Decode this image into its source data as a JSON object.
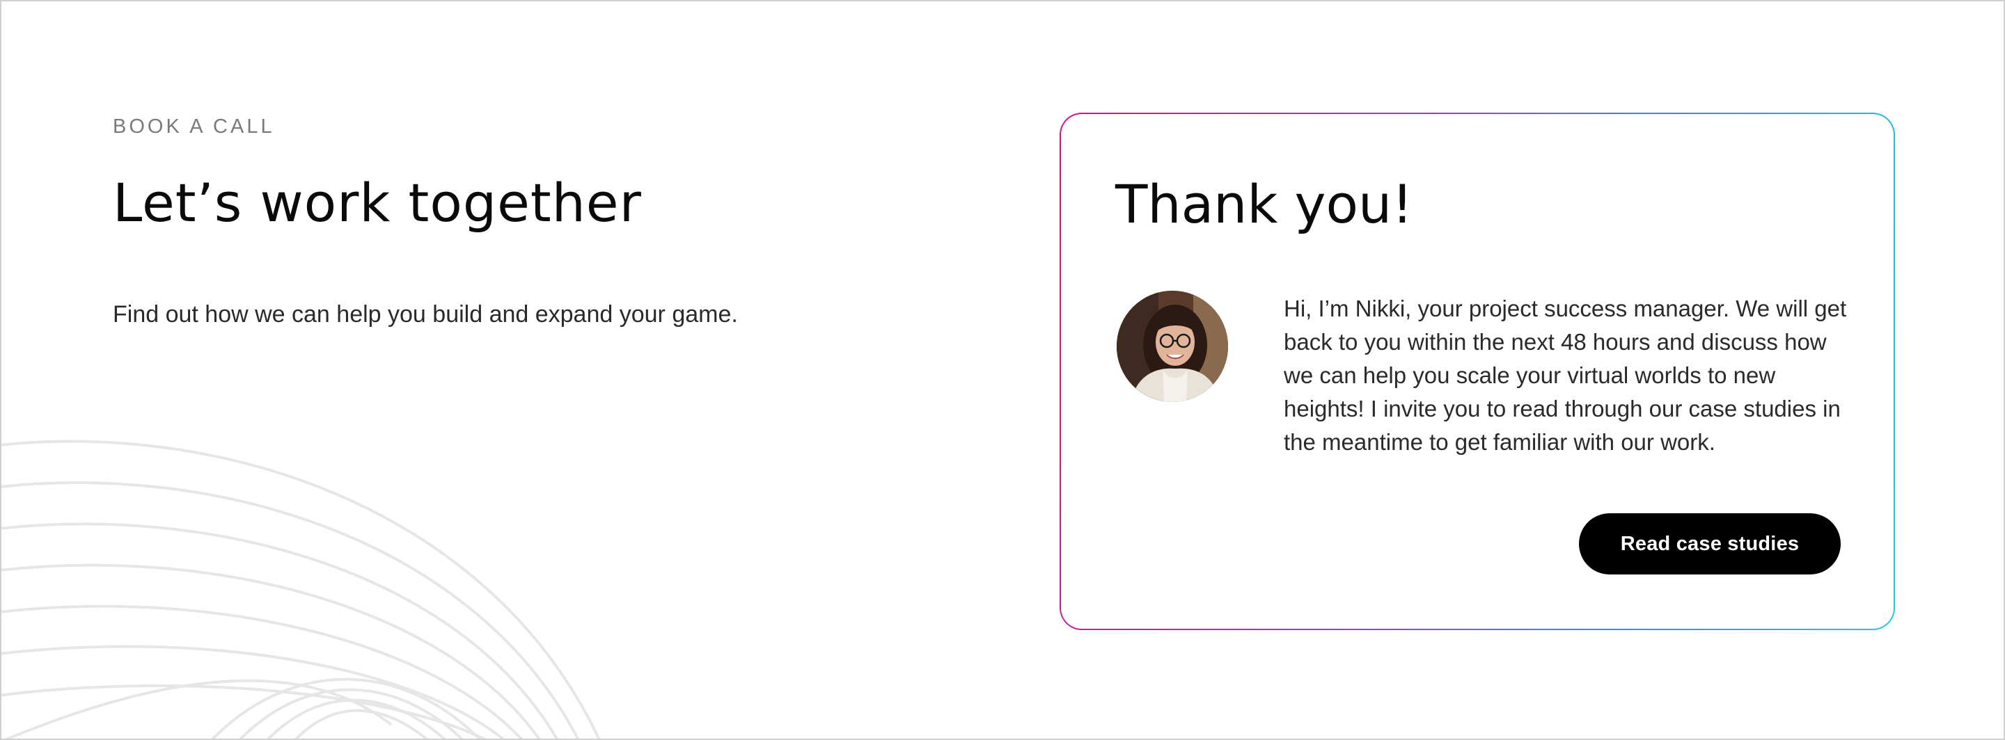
{
  "section": {
    "eyebrow": "BOOK A CALL",
    "headline": "Let’s work together",
    "lead": "Find out how we can help you build and expand your game."
  },
  "card": {
    "title": "Thank you!",
    "message": "Hi, I’m Nikki, your project success manager. We will get back to you within the next 48 hours and discuss how we can help you scale your virtual worlds to new heights! I invite you to read through our case studies in the meantime to get familiar with our work.",
    "cta_label": "Read case studies",
    "avatar_icon": "person-portrait",
    "border_gradient": [
      "#d0148a",
      "#9b3fbf",
      "#3a8ee0",
      "#25c8e0"
    ]
  },
  "colors": {
    "background": "#ffffff",
    "text": "#0a0a0a",
    "muted": "#7a7a7a",
    "button": "#000000",
    "button_text": "#ffffff",
    "decor_lines": "#e6e6e6"
  }
}
